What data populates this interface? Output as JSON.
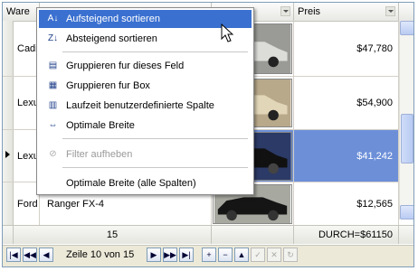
{
  "header": {
    "col_make": "Ware",
    "col_price": "Preis"
  },
  "rows": [
    {
      "make": "Cadillac",
      "model": "",
      "price": "$47,780",
      "selected": false
    },
    {
      "make": "Lexus",
      "model": "",
      "price": "$54,900",
      "selected": false
    },
    {
      "make": "Lexus",
      "model": "",
      "price": "$41,242",
      "selected": true
    },
    {
      "make": "Ford",
      "model": "Ranger FX-4",
      "price": "$12,565",
      "selected": false
    }
  ],
  "footer": {
    "count": "15",
    "summary": "DURCH=$61150"
  },
  "navigator": {
    "position_text": "Zeile 10 von 15"
  },
  "context_menu": {
    "items": [
      {
        "label": "Aufsteigend sortieren",
        "icon": "sort-ascending-icon",
        "state": "highlighted"
      },
      {
        "label": "Absteigend sortieren",
        "icon": "sort-descending-icon",
        "state": "normal"
      },
      {
        "label": "Gruppieren fur dieses Feld",
        "icon": "group-field-icon",
        "state": "normal"
      },
      {
        "label": "Gruppieren fur Box",
        "icon": "group-box-icon",
        "state": "normal"
      },
      {
        "label": "Laufzeit benutzerdefinierte Spalte",
        "icon": "custom-column-icon",
        "state": "normal"
      },
      {
        "label": "Optimale Breite",
        "icon": "best-fit-icon",
        "state": "normal"
      },
      {
        "label": "Filter aufheben",
        "icon": "clear-filter-icon",
        "state": "disabled"
      },
      {
        "label": "Optimale Breite (alle Spalten)",
        "icon": "",
        "state": "normal"
      }
    ]
  },
  "colors": {
    "selection": "#6c8fd8",
    "menu_highlight": "#3a70d0",
    "border": "#7f9db9"
  }
}
